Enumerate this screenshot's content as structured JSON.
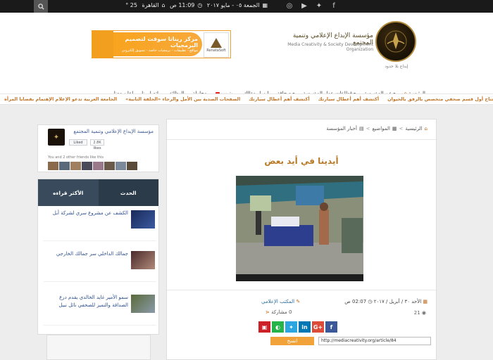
{
  "topbar": {
    "city": "القاهرة",
    "temperature": "25 °",
    "time": "11:09 ص",
    "date": "الجمعة ٠٥ - مايو ٢٠١٧"
  },
  "header": {
    "org_name_ar": "مؤسسة الإبداع الإعلامي وتنمية المجتمع",
    "org_name_en": "Media Creativity & Society Development Organization",
    "logo_tagline": "إبداع بلا حدود",
    "ad_title": "مركز ريناتا سوفت لتصميم البرمجيات",
    "ad_subtitle": "مواقع - تطبيقات - برمجيات خاصة - تسويق إلكتروني",
    "ad_logo_text": "RenataSoft"
  },
  "nav": [
    {
      "label": "الرئيسية",
      "icon": "home-icon",
      "caret": false
    },
    {
      "label": "عن المؤسسة",
      "caret": true
    },
    {
      "label": "قطاعات عمل المؤسسة",
      "caret": true
    },
    {
      "label": "صحافة",
      "caret": true
    },
    {
      "label": "ارسل مقالك",
      "caret": false
    },
    {
      "label": "يوتيوب",
      "caret": false,
      "icon": "youtube-icon"
    },
    {
      "label": "محلولة",
      "caret": false
    },
    {
      "label": "الوظائف",
      "caret": false
    },
    {
      "label": "اتصل بنا",
      "caret": false
    },
    {
      "label": "اعلن معنا",
      "caret": false
    }
  ],
  "ticker": [
    "الجامعة العربية تدعو الإعلام الإهتمام بقضايا المرأة",
    "الصفحات الصدية بين الأمل والرجاء «الحلقة الثانية»",
    "أكتشف أهم أعطال سيارتك",
    "أكتشف أهم أعطال سيارتك",
    "إفتتاح أول قسم صحفي متخصص بالرفق بالحيوان",
    "يوم ال"
  ],
  "article": {
    "breadcrumb": [
      "الرئيسية",
      "المواضيع",
      "أخبار المؤسسة"
    ],
    "title": "أيدينا في أيد بعض",
    "day": "الأحد ٣٠ / أبريل / ٢٠١٧",
    "time": "02:07 ص",
    "author": "المكتب الإعلامي",
    "views": "21",
    "shares_count": "0",
    "shares_label": "مشاركة",
    "url": "http://mediacreativity.org/article/84",
    "copy_label": "انسخ"
  },
  "facebook": {
    "page_name": "مؤسسة الإبداع الإعلامي وتنمية المجتمع",
    "like_label": "Liked",
    "like_count": "2.8K likes",
    "friends_text": "You and 2 other friends like this"
  },
  "sidebar": {
    "tab_latest": "الحدث",
    "tab_most_read": "الأكثر قراءه",
    "items": [
      {
        "title": "الكشف عن مشروع سري لشركة أبل"
      },
      {
        "title": "جمالك الداخلي سر جمالك الخارجي"
      },
      {
        "title": "سمو الأمير غايد الخالدي يقدم درع الصداقة والتميز للصحفي نائل نبيل"
      }
    ]
  },
  "colors": {
    "accent": "#b77a26",
    "link": "#2d4f8f",
    "ticker": "#c1762a",
    "topbar": "#1a1a1a",
    "tab_dark": "#2b3b4a"
  }
}
